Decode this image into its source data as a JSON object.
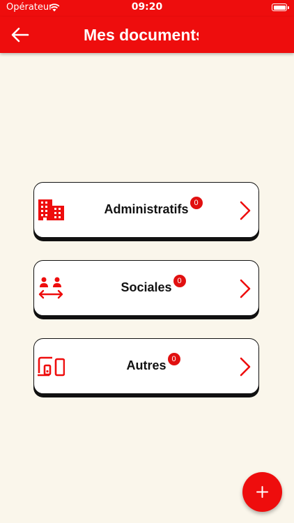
{
  "status_bar": {
    "carrier": "Opérateur",
    "time": "09:20"
  },
  "header": {
    "title": "Mes documents",
    "back_icon": "arrow-left-icon"
  },
  "categories": [
    {
      "label": "Administratifs",
      "count": "0",
      "icon": "building-icon"
    },
    {
      "label": "Sociales",
      "count": "0",
      "icon": "people-exchange-icon"
    },
    {
      "label": "Autres",
      "count": "0",
      "icon": "devices-icon"
    }
  ],
  "fab": {
    "icon": "plus-icon"
  },
  "colors": {
    "primary": "#ee0d0d",
    "background": "#faf6eb",
    "card": "#ffffff",
    "border": "#111111"
  }
}
